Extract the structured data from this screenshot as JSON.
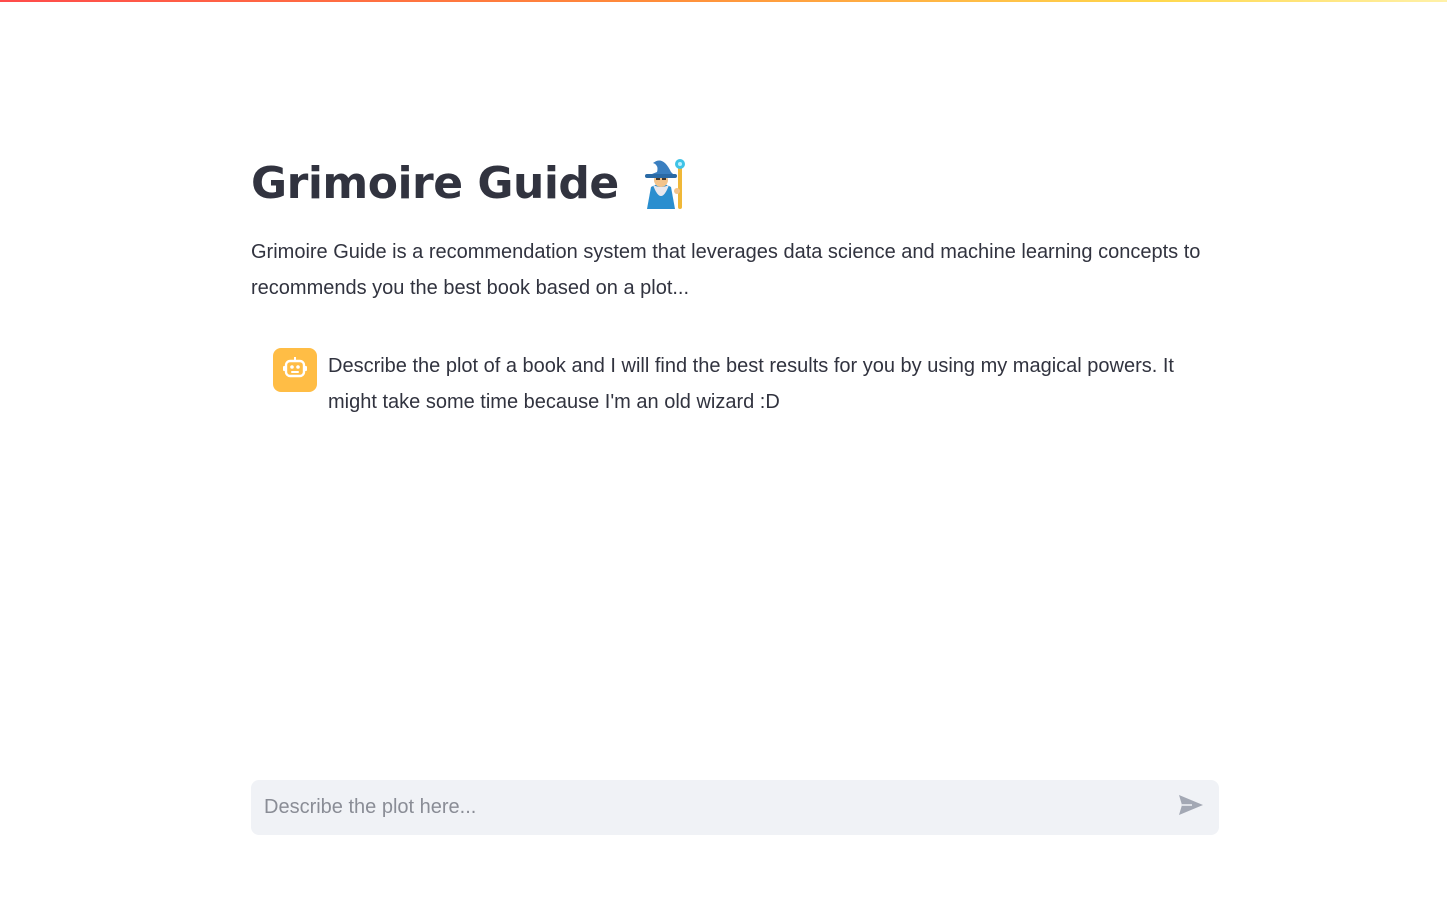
{
  "page": {
    "title": "Grimoire Guide",
    "title_emoji": "wizard-icon",
    "description": "Grimoire Guide is a recommendation system that leverages data science and machine learning concepts to recommends you the best book based on a plot..."
  },
  "chat": {
    "messages": [
      {
        "role": "assistant",
        "avatar_icon": "robot-icon",
        "text": "Describe the plot of a book and I will find the best results for you by using my magical powers. It might take some time because I'm an old wizard :D"
      }
    ],
    "input": {
      "value": "",
      "placeholder": "Describe the plot here...",
      "send_icon": "send-icon"
    }
  },
  "colors": {
    "text": "#31333f",
    "avatar_bg": "#ffbd45",
    "input_bg": "#f0f2f6",
    "placeholder": "#8a8d96",
    "top_gradient_start": "#ff4b4b",
    "top_gradient_end": "#fff1a8"
  }
}
